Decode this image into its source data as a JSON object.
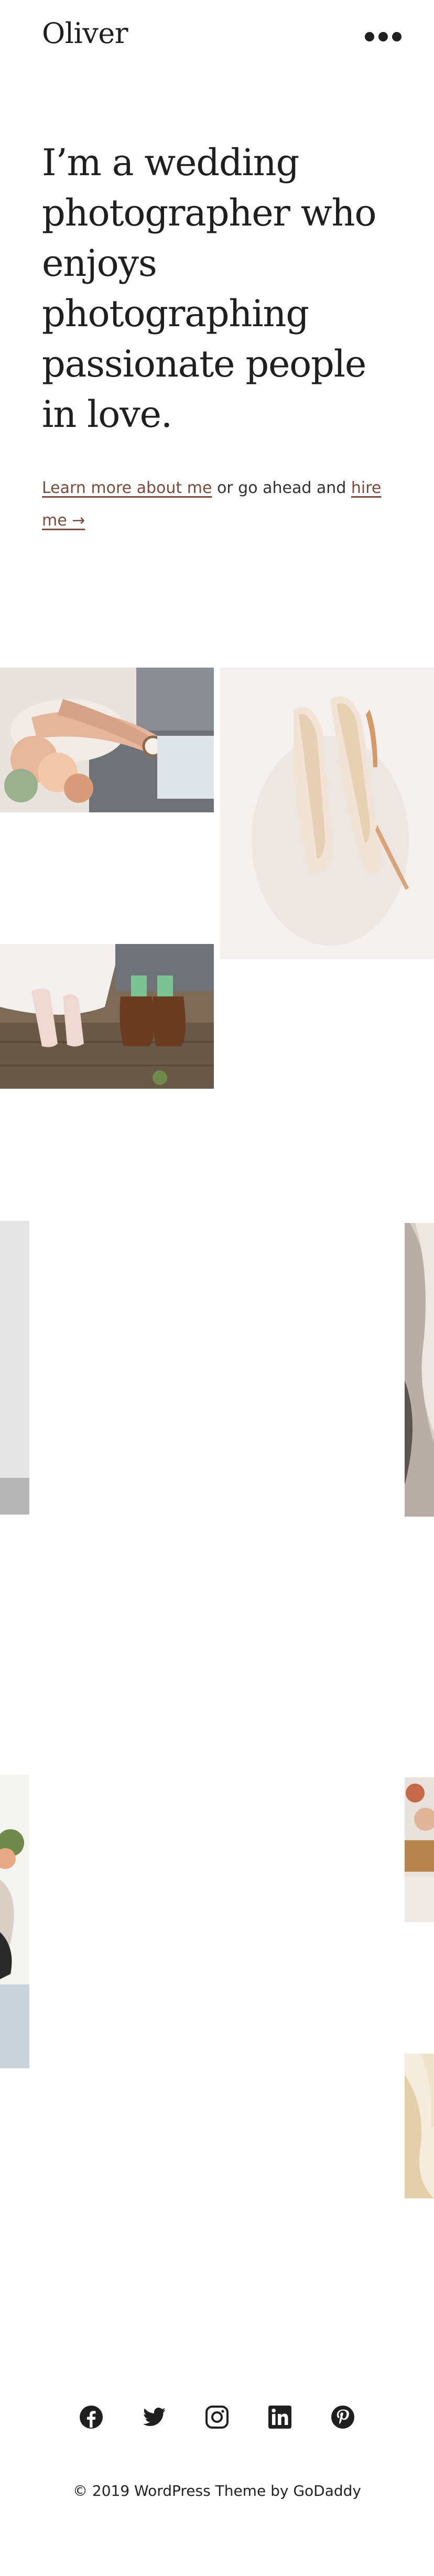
{
  "header": {
    "site_title": "Oliver",
    "menu_icon": "more-dots-icon"
  },
  "hero": {
    "heading": "I’m a wedding photographer who enjoys photographing passionate people in love.",
    "learn_more_link": "Learn more about me",
    "middle_text": " or go ahead and ",
    "hire_link": "hire me →"
  },
  "gallery": {
    "photos": [
      "hands-rings-bouquet-photo",
      "bridal-heels-photo",
      "couple-shoes-photo",
      "partial-photo-left",
      "partial-photo-right",
      "partial-bride-bouquet-photo",
      "partial-flowers-photo",
      "partial-dress-photo"
    ]
  },
  "social": {
    "icons": [
      "facebook-icon",
      "twitter-icon",
      "instagram-icon",
      "linkedin-icon",
      "pinterest-icon"
    ]
  },
  "footer": {
    "copyright": "© 2019  WordPress Theme by GoDaddy"
  }
}
